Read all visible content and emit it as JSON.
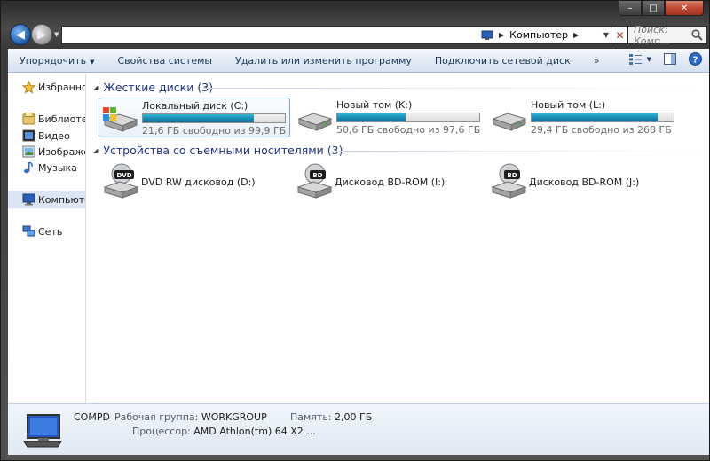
{
  "window": {
    "controls": {
      "minimize": "–",
      "maximize": "□",
      "close": "✕"
    }
  },
  "address": {
    "location": "Компьютер",
    "search_placeholder": "Поиск: Комп...",
    "accent_green": "#8edc71"
  },
  "toolbar": {
    "organize": "Упорядочить",
    "system_properties": "Свойства системы",
    "uninstall": "Удалить или изменить программу",
    "map_drive": "Подключить сетевой диск",
    "more": "»"
  },
  "sidebar": {
    "favorites": "Избранное",
    "libraries": "Библиотеки",
    "video": "Видео",
    "images": "Изображения",
    "music": "Музыка",
    "computer": "Компьютер",
    "network": "Сеть"
  },
  "hard_disks": {
    "header": "Жесткие диски (3)",
    "drives": [
      {
        "name": "Локальный диск (C:)",
        "free": "21,6 ГБ свободно из 99,9 ГБ",
        "used_fraction": 0.78,
        "icon": "windows-drive-icon"
      },
      {
        "name": "Новый том (K:)",
        "free": "50,6 ГБ свободно из 97,6 ГБ",
        "used_fraction": 0.48,
        "icon": "hard-drive-icon"
      },
      {
        "name": "Новый том (L:)",
        "free": "29,4 ГБ свободно из 268 ГБ",
        "used_fraction": 0.89,
        "icon": "hard-drive-icon"
      }
    ]
  },
  "removable": {
    "header": "Устройства со съемными носителями (3)",
    "drives": [
      {
        "name": "DVD RW дисковод (D:)",
        "badge": "DVD",
        "icon": "dvd-drive-icon"
      },
      {
        "name": "Дисковод BD-ROM (I:)",
        "badge": "BD",
        "icon": "bd-drive-icon"
      },
      {
        "name": "Дисковод BD-ROM (J:)",
        "badge": "BD",
        "icon": "bd-drive-icon"
      }
    ]
  },
  "details": {
    "computer_name": "COMPD",
    "workgroup_label": "Рабочая группа:",
    "workgroup": "WORKGROUP",
    "memory_label": "Память:",
    "memory": "2,00 ГБ",
    "cpu_label": "Процессор:",
    "cpu": "AMD Athlon(tm) 64 X2 ..."
  },
  "colors": {
    "progress_bar": "#1c8fb8",
    "group_header": "#1e3287",
    "selection": "#dbe5f3"
  }
}
